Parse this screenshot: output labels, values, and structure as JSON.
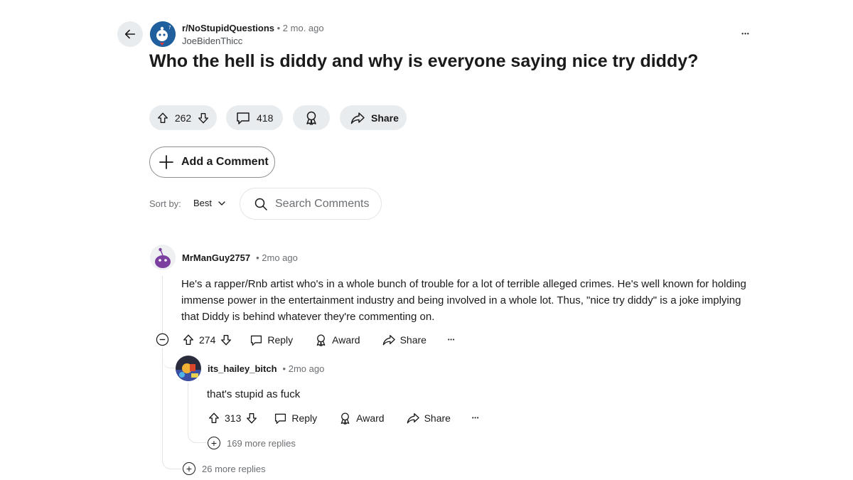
{
  "post": {
    "subreddit": "r/NoStupidQuestions",
    "time": "• 2 mo. ago",
    "author": "JoeBidenThicc",
    "more": "•••",
    "title": "Who the hell is diddy and why is everyone saying nice try diddy?",
    "votes": "262",
    "comments": "418",
    "share_label": "Share"
  },
  "add_comment_label": "Add a Comment",
  "sort": {
    "label": "Sort by:",
    "value": "Best"
  },
  "search": {
    "placeholder": "Search Comments"
  },
  "comments": [
    {
      "user": "MrManGuy2757",
      "time": "• 2mo ago",
      "body": "He's a rapper/Rnb artist who's in a whole bunch of trouble for a lot of terrible alleged crimes. He's well known for holding immense power in the entertainment industry and being involved in a whole lot. Thus, \"nice try diddy\" is a joke implying that Diddy is behind whatever they're commenting on.",
      "votes": "274",
      "reply_label": "Reply",
      "award_label": "Award",
      "share_label": "Share",
      "more": "•••",
      "more_replies": "26 more replies",
      "replies": [
        {
          "user": "its_hailey_bitch",
          "time": "• 2mo ago",
          "body": "that's stupid as fuck",
          "votes": "313",
          "reply_label": "Reply",
          "award_label": "Award",
          "share_label": "Share",
          "more": "•••",
          "more_replies": "169 more replies"
        }
      ]
    }
  ],
  "colors": {
    "pill_bg": "#e9ecee",
    "subreddit_avatar": "#1f5f9e",
    "snoo_purple": "#7b3fa0",
    "meta_text": "#6b6f73"
  },
  "icons": [
    "back-arrow-icon",
    "upvote-icon",
    "downvote-icon",
    "comment-icon",
    "award-icon",
    "share-icon",
    "plus-icon",
    "chevron-down-icon",
    "search-icon",
    "collapse-icon",
    "plus-circle-icon"
  ]
}
